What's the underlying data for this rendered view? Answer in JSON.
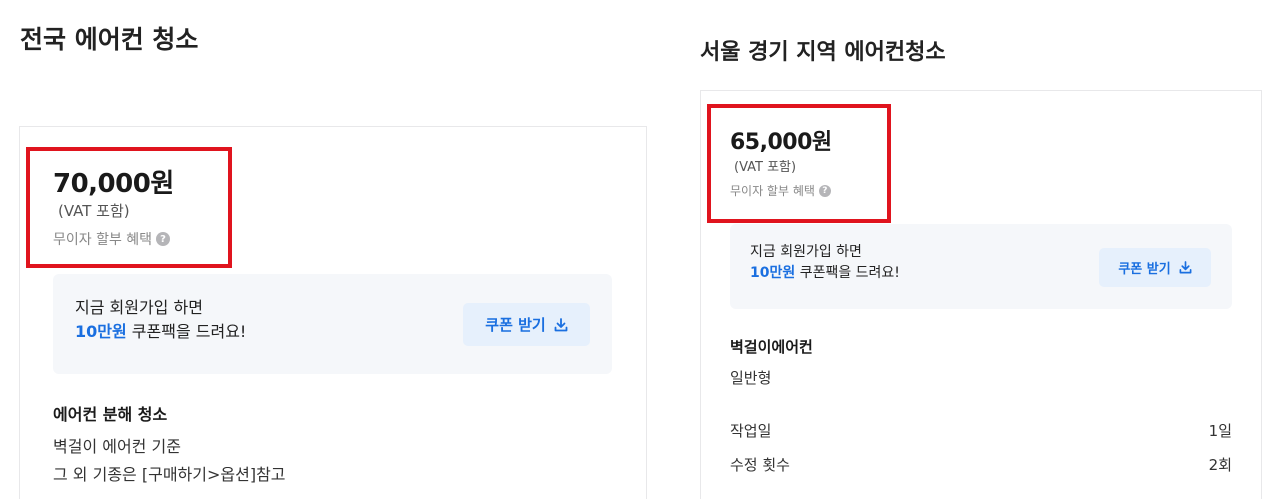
{
  "left": {
    "title": "전국 에어컨 청소",
    "price": "70,000원",
    "vat": "(VAT 포함)",
    "benefit": "무이자 할부 혜택",
    "coupon": {
      "line1": "지금 회원가입 하면",
      "highlight": "10만원",
      "line2_rest": " 쿠폰팩을 드려요!",
      "button": "쿠폰 받기"
    },
    "section": {
      "title": "에어컨 분해 청소",
      "lines": [
        "벽걸이 에어컨 기준",
        "그 외 기종은 [구매하기>옵션]참고"
      ]
    }
  },
  "right": {
    "title": "서울 경기 지역 에어컨청소",
    "price": "65,000원",
    "vat": "(VAT 포함)",
    "benefit": "무이자 할부 혜택",
    "coupon": {
      "line1": "지금 회원가입 하면",
      "highlight": "10만원",
      "line2_rest": " 쿠폰팩을 드려요!",
      "button": "쿠폰 받기"
    },
    "section": {
      "title": "벽걸이에어컨",
      "subtitle": "일반형"
    },
    "rows": [
      {
        "label": "작업일",
        "value": "1일"
      },
      {
        "label": "수정 횟수",
        "value": "2회"
      }
    ]
  },
  "colors": {
    "highlight_box": "#e0141e",
    "accent": "#1a6fe0"
  },
  "icons": {
    "question": "?",
    "download": "download-icon"
  }
}
